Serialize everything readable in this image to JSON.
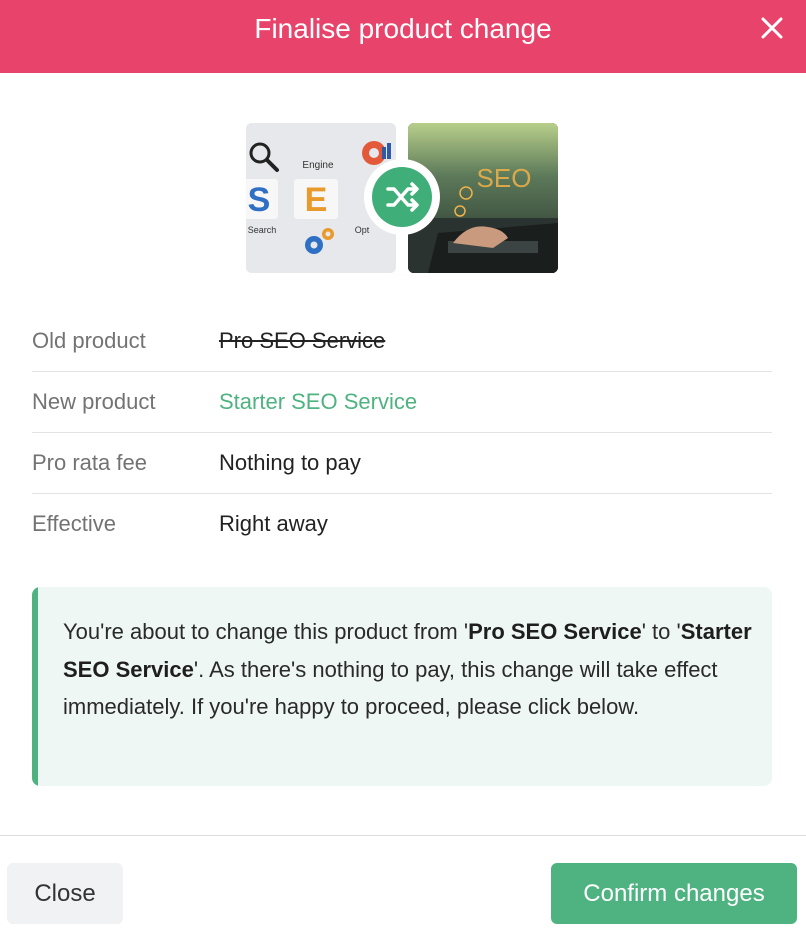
{
  "modal": {
    "title": "Finalise product change",
    "close_icon": "close-icon",
    "accent_color": "#e8436a"
  },
  "images": {
    "old": {
      "icon": "seo-blocks-image",
      "letters": [
        "S",
        "E"
      ],
      "words": [
        "Engine",
        "Search",
        "Opt"
      ]
    },
    "new": {
      "icon": "seo-laptop-image",
      "letters": "SEO"
    },
    "swap_icon": "shuffle-icon"
  },
  "details": [
    {
      "label": "Old product",
      "value": "Pro SEO Service"
    },
    {
      "label": "New product",
      "value": "Starter SEO Service"
    },
    {
      "label": "Pro rata fee",
      "value": "Nothing to pay"
    },
    {
      "label": "Effective",
      "value": "Right away"
    }
  ],
  "notice": {
    "part1": "You're about to change this product from '",
    "old_product": "Pro SEO Service",
    "part2": "' to '",
    "new_product": "Starter SEO Service",
    "part3": "'. As there's nothing to pay, this change will take effect immediately. If you're happy to proceed, please click below."
  },
  "footer": {
    "close_label": "Close",
    "confirm_label": "Confirm changes",
    "confirm_color": "#4fb381"
  }
}
